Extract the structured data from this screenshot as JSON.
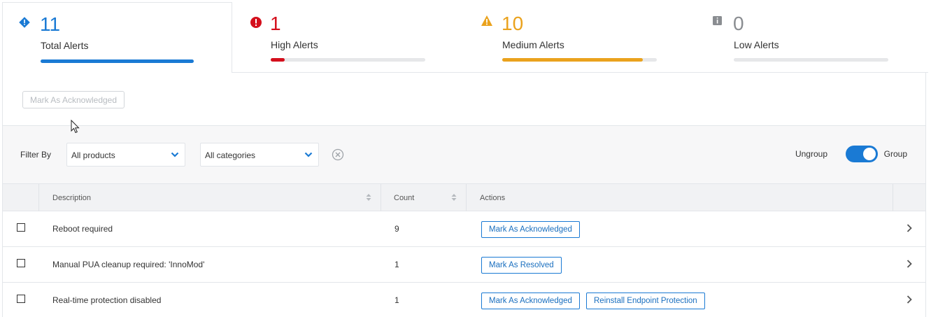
{
  "summary": {
    "tabs": [
      {
        "count": "11",
        "label": "Total Alerts",
        "color": "#1a7ad4",
        "fill": 1.0,
        "icon": "diamond-info-icon"
      },
      {
        "count": "1",
        "label": "High Alerts",
        "color": "#d40f1c",
        "fill": 0.09,
        "icon": "exclamation-circle-icon"
      },
      {
        "count": "10",
        "label": "Medium Alerts",
        "color": "#eaa21d",
        "fill": 0.91,
        "icon": "warning-triangle-icon"
      },
      {
        "count": "0",
        "label": "Low Alerts",
        "color": "#8a8d91",
        "fill": 0.0,
        "icon": "info-square-icon"
      }
    ]
  },
  "toolbar": {
    "ack_label": "Mark As Acknowledged"
  },
  "filter": {
    "label": "Filter By",
    "products": "All products",
    "categories": "All categories",
    "toggle_left": "Ungroup",
    "toggle_right": "Group",
    "toggle_on": true
  },
  "table": {
    "columns": {
      "description": "Description",
      "count": "Count",
      "actions": "Actions"
    },
    "rows": [
      {
        "description": "Reboot required",
        "count": "9",
        "actions": [
          "Mark As Acknowledged"
        ]
      },
      {
        "description": "Manual PUA cleanup required: 'InnoMod'",
        "count": "1",
        "actions": [
          "Mark As Resolved"
        ]
      },
      {
        "description": "Real-time protection disabled",
        "count": "1",
        "actions": [
          "Mark As Acknowledged",
          "Reinstall Endpoint Protection"
        ]
      }
    ]
  },
  "colors": {
    "accent": "#1a7ad4",
    "high": "#d40f1c",
    "medium": "#eaa21d",
    "low": "#8a8d91"
  }
}
